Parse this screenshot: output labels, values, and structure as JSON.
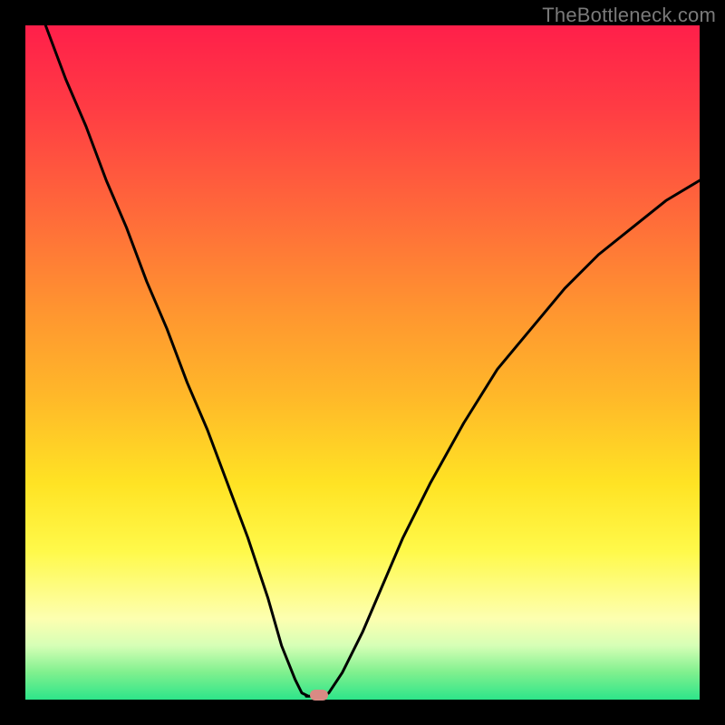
{
  "watermark": "TheBottleneck.com",
  "colors": {
    "frame": "#000000",
    "gradient_top": "#ff1f4a",
    "gradient_bottom": "#2de58a",
    "curve": "#000000",
    "marker": "#d98a84"
  },
  "chart_data": {
    "type": "line",
    "title": "",
    "xlabel": "",
    "ylabel": "",
    "xlim": [
      0,
      100
    ],
    "ylim": [
      0,
      100
    ],
    "grid": false,
    "legend": false,
    "x": [
      3,
      6,
      9,
      12,
      15,
      18,
      21,
      24,
      27,
      30,
      33,
      36,
      38,
      40,
      41,
      42,
      43,
      44,
      45,
      47,
      50,
      53,
      56,
      60,
      65,
      70,
      75,
      80,
      85,
      90,
      95,
      100
    ],
    "y": [
      100,
      92,
      85,
      77,
      70,
      62,
      55,
      47,
      40,
      32,
      24,
      15,
      8,
      3,
      1,
      0.5,
      0.5,
      0.5,
      1,
      4,
      10,
      17,
      24,
      32,
      41,
      49,
      55,
      61,
      66,
      70,
      74,
      77
    ],
    "minimum": {
      "x": 43,
      "y": 0.5
    },
    "marker": {
      "x": 43.5,
      "y": 0
    }
  }
}
